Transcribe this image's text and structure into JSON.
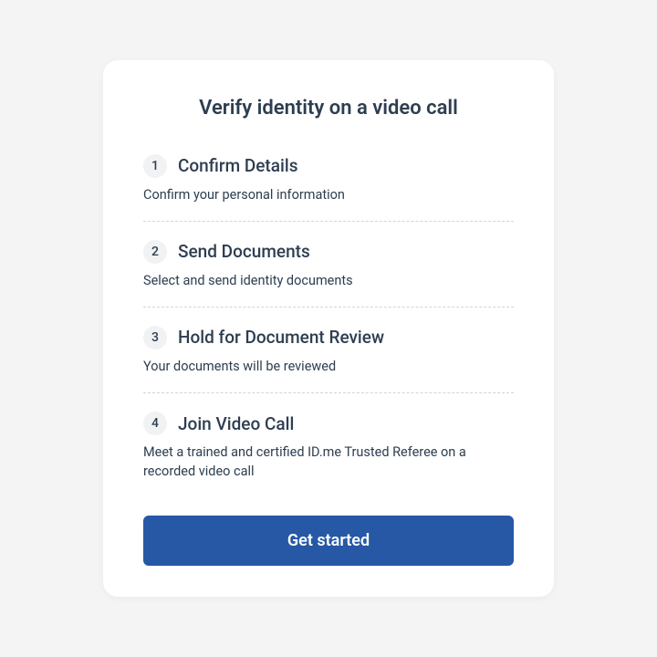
{
  "title": "Verify identity on a video call",
  "steps": [
    {
      "num": "1",
      "title": "Confirm Details",
      "desc": "Confirm your personal information"
    },
    {
      "num": "2",
      "title": "Send Documents",
      "desc": "Select and send identity documents"
    },
    {
      "num": "3",
      "title": "Hold for Document Review",
      "desc": "Your documents will be reviewed"
    },
    {
      "num": "4",
      "title": "Join Video Call",
      "desc": "Meet a trained and certified ID.me Trusted Referee on a recorded video call"
    }
  ],
  "cta": "Get started"
}
